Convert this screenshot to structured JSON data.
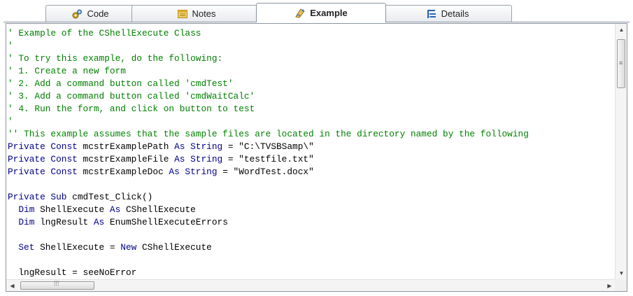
{
  "tabs": [
    {
      "label": "Code",
      "icon": "code-icon"
    },
    {
      "label": "Notes",
      "icon": "notes-icon"
    },
    {
      "label": "Example",
      "icon": "example-icon",
      "active": true
    },
    {
      "label": "Details",
      "icon": "details-icon"
    }
  ],
  "colors": {
    "comment": "#008000",
    "keyword": "#00008b",
    "text": "#000000",
    "tab_border": "#8b95a1"
  },
  "code_lines": [
    [
      {
        "t": "' Example of the CShellExecute Class",
        "c": "cm"
      }
    ],
    [
      {
        "t": "'",
        "c": "cm"
      }
    ],
    [
      {
        "t": "' To try this example, do the following:",
        "c": "cm"
      }
    ],
    [
      {
        "t": "' 1. Create a new form",
        "c": "cm"
      }
    ],
    [
      {
        "t": "' 2. Add a command button called 'cmdTest'",
        "c": "cm"
      }
    ],
    [
      {
        "t": "' 3. Add a command button called 'cmdWaitCalc'",
        "c": "cm"
      }
    ],
    [
      {
        "t": "' 4. Run the form, and click on button to test",
        "c": "cm"
      }
    ],
    [
      {
        "t": "'",
        "c": "cm"
      }
    ],
    [
      {
        "t": "'' This example assumes that the sample files are located in the directory named by the following",
        "c": "cm"
      }
    ],
    [
      {
        "t": "Private Const ",
        "c": "kw"
      },
      {
        "t": "mcstrExamplePath ",
        "c": "tx"
      },
      {
        "t": "As String",
        "c": "kw"
      },
      {
        "t": " = \"C:\\TVSBSamp\\\"",
        "c": "tx"
      }
    ],
    [
      {
        "t": "Private Const ",
        "c": "kw"
      },
      {
        "t": "mcstrExampleFile ",
        "c": "tx"
      },
      {
        "t": "As String",
        "c": "kw"
      },
      {
        "t": " = \"testfile.txt\"",
        "c": "tx"
      }
    ],
    [
      {
        "t": "Private Const ",
        "c": "kw"
      },
      {
        "t": "mcstrExampleDoc ",
        "c": "tx"
      },
      {
        "t": "As String",
        "c": "kw"
      },
      {
        "t": " = \"WordTest.docx\"",
        "c": "tx"
      }
    ],
    [],
    [
      {
        "t": "Private Sub ",
        "c": "kw"
      },
      {
        "t": "cmdTest_Click()",
        "c": "tx"
      }
    ],
    [
      {
        "t": "  Dim ",
        "c": "kw"
      },
      {
        "t": "ShellExecute ",
        "c": "tx"
      },
      {
        "t": "As ",
        "c": "kw"
      },
      {
        "t": "CShellExecute",
        "c": "tx"
      }
    ],
    [
      {
        "t": "  Dim ",
        "c": "kw"
      },
      {
        "t": "lngResult ",
        "c": "tx"
      },
      {
        "t": "As ",
        "c": "kw"
      },
      {
        "t": "EnumShellExecuteErrors",
        "c": "tx"
      }
    ],
    [],
    [
      {
        "t": "  Set ",
        "c": "kw"
      },
      {
        "t": "ShellExecute = ",
        "c": "tx"
      },
      {
        "t": "New ",
        "c": "kw"
      },
      {
        "t": "CShellExecute",
        "c": "tx"
      }
    ],
    [],
    [
      {
        "t": "  lngResult = seeNoError",
        "c": "tx"
      }
    ]
  ],
  "scroll": {
    "vertical_position": 0.0,
    "horizontal_position": 0.0
  }
}
